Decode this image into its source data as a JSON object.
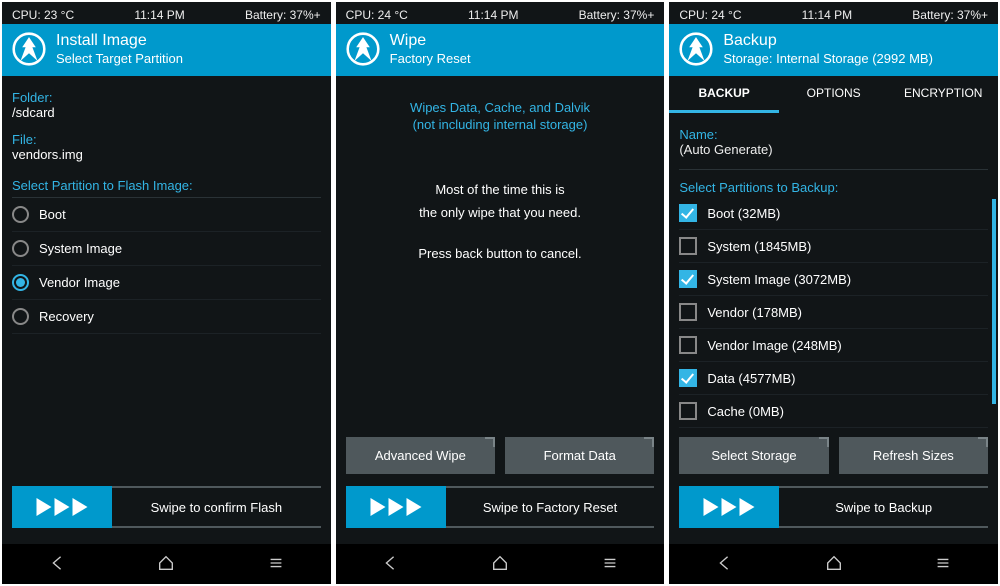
{
  "screens": [
    {
      "status": {
        "cpu": "CPU: 23 °C",
        "time": "11:14 PM",
        "battery": "Battery: 37%+"
      },
      "header": {
        "title": "Install Image",
        "subtitle": "Select Target Partition"
      },
      "folder_label": "Folder:",
      "folder_value": "/sdcard",
      "file_label": "File:",
      "file_value": "vendors.img",
      "section": "Select Partition to Flash Image:",
      "partitions": [
        {
          "label": "Boot",
          "checked": false
        },
        {
          "label": "System Image",
          "checked": false
        },
        {
          "label": "Vendor Image",
          "checked": true
        },
        {
          "label": "Recovery",
          "checked": false
        }
      ],
      "swipe": "Swipe to confirm Flash"
    },
    {
      "status": {
        "cpu": "CPU: 24 °C",
        "time": "11:14 PM",
        "battery": "Battery: 37%+"
      },
      "header": {
        "title": "Wipe",
        "subtitle": "Factory Reset"
      },
      "info1": "Wipes Data, Cache, and Dalvik",
      "info2": "(not including internal storage)",
      "body1": "Most of the time this is",
      "body2": "the only wipe that you need.",
      "body3": "Press back button to cancel.",
      "btn_left": "Advanced Wipe",
      "btn_right": "Format Data",
      "swipe": "Swipe to Factory Reset"
    },
    {
      "status": {
        "cpu": "CPU: 24 °C",
        "time": "11:14 PM",
        "battery": "Battery: 37%+"
      },
      "header": {
        "title": "Backup",
        "subtitle": "Storage: Internal Storage (2992 MB)"
      },
      "tabs": [
        "BACKUP",
        "OPTIONS",
        "ENCRYPTION"
      ],
      "active_tab": 0,
      "name_label": "Name:",
      "name_value": "(Auto Generate)",
      "section": "Select Partitions to Backup:",
      "parts": [
        {
          "label": "Boot (32MB)",
          "checked": true
        },
        {
          "label": "System (1845MB)",
          "checked": false
        },
        {
          "label": "System Image (3072MB)",
          "checked": true
        },
        {
          "label": "Vendor (178MB)",
          "checked": false
        },
        {
          "label": "Vendor Image (248MB)",
          "checked": false
        },
        {
          "label": "Data (4577MB)",
          "checked": true
        },
        {
          "label": "Cache (0MB)",
          "checked": false
        }
      ],
      "btn_left": "Select Storage",
      "btn_right": "Refresh Sizes",
      "swipe": "Swipe to Backup"
    }
  ]
}
